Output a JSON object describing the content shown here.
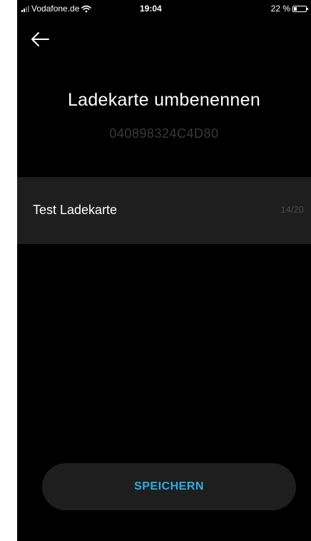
{
  "status_bar": {
    "carrier": "Vodafone.de",
    "time": "19:04",
    "battery_percent_label": "22 %",
    "battery_level": 0.22
  },
  "header": {
    "title": "Ladekarte umbenennen",
    "card_id": "040898324C4D80"
  },
  "form": {
    "name_value": "Test Ladekarte",
    "char_count": "14/20"
  },
  "actions": {
    "save_label": "SPEICHERN"
  },
  "colors": {
    "background": "#000000",
    "field_background": "#1e1e1e",
    "accent": "#2eaee0"
  },
  "icons": {
    "back": "arrow-left-icon",
    "signal": "signal-icon",
    "wifi": "wifi-icon",
    "battery": "battery-icon"
  }
}
